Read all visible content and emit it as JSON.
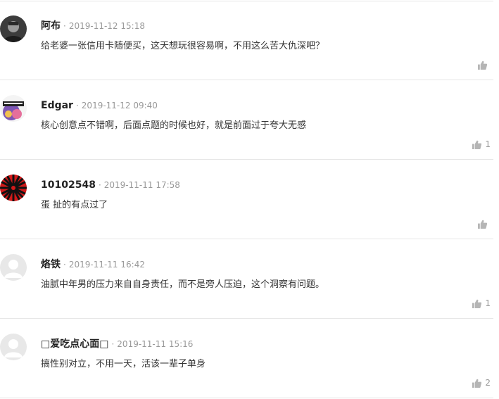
{
  "comments": [
    {
      "name": "阿布",
      "time": "2019-11-12 15:18",
      "text": "给老婆一张信用卡随便买，这天想玩很容易啊，不用这么苦大仇深吧？",
      "likes": "",
      "avatar_icon": "portrait-avatar-icon"
    },
    {
      "name": "Edgar",
      "time": "2019-11-12 09:40",
      "text": "核心创意点不错啊，后面点题的时候也好，就是前面过于夸大无感",
      "likes": "1",
      "avatar_icon": "colorful-graphic-avatar-icon"
    },
    {
      "name": "10102548",
      "time": "2019-11-11 17:58",
      "text": "蛋 扯的有点过了",
      "likes": "",
      "avatar_icon": "red-black-sunburst-avatar-icon"
    },
    {
      "name": "烙铁",
      "time": "2019-11-11 16:42",
      "text": "油腻中年男的压力来自自身责任，而不是旁人压迫，这个洞察有问题。",
      "likes": "1",
      "avatar_icon": "default-user-avatar-icon"
    },
    {
      "name": "□爱吃点心面□",
      "time": "2019-11-11 15:16",
      "text": "搞性别对立，不用一天，活该一辈子单身",
      "likes": "2",
      "avatar_icon": "default-user-avatar-icon"
    }
  ],
  "separator": "·",
  "like_icon": "thumbs-up-icon",
  "colors": {
    "name": "#222222",
    "meta": "#999999",
    "text": "#333333",
    "divider": "#e6e6e6",
    "icon": "#b5b5b5"
  }
}
